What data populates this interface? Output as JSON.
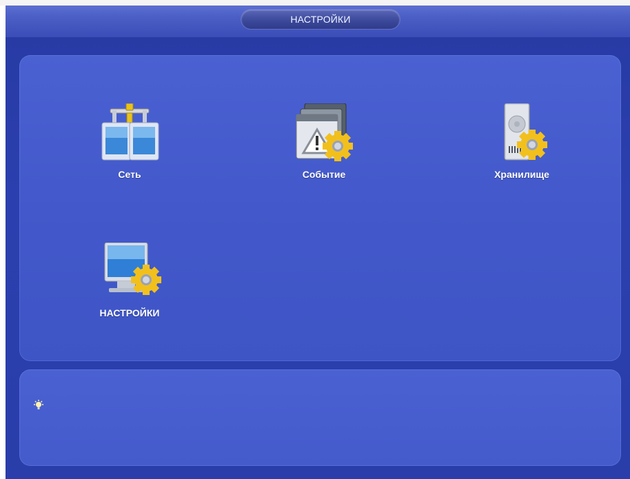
{
  "window": {
    "title": "НАСТРОЙКИ"
  },
  "menu": {
    "items": [
      {
        "label": "Сеть",
        "icon": "network-icon"
      },
      {
        "label": "Событие",
        "icon": "event-icon"
      },
      {
        "label": "Хранилище",
        "icon": "storage-icon"
      },
      {
        "label": "НАСТРОЙКИ",
        "icon": "system-settings-icon"
      }
    ]
  },
  "hint": {
    "icon": "lightbulb-icon",
    "text": ""
  },
  "colors": {
    "background": "#2a3eaa",
    "panel": "#4359cb",
    "title_bar": "#4c5fc6",
    "gear": "#f2c01c",
    "label": "#ffffff"
  }
}
